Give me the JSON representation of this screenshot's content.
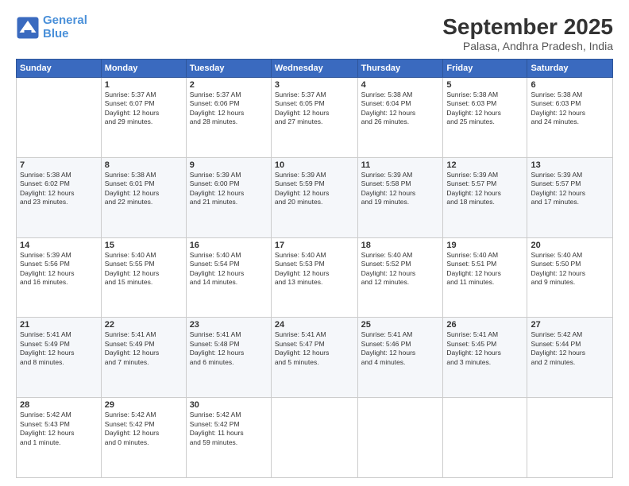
{
  "app": {
    "logo_line1": "General",
    "logo_line2": "Blue"
  },
  "header": {
    "title": "September 2025",
    "subtitle": "Palasa, Andhra Pradesh, India"
  },
  "weekdays": [
    "Sunday",
    "Monday",
    "Tuesday",
    "Wednesday",
    "Thursday",
    "Friday",
    "Saturday"
  ],
  "weeks": [
    [
      {
        "day": "",
        "info": ""
      },
      {
        "day": "1",
        "info": "Sunrise: 5:37 AM\nSunset: 6:07 PM\nDaylight: 12 hours\nand 29 minutes."
      },
      {
        "day": "2",
        "info": "Sunrise: 5:37 AM\nSunset: 6:06 PM\nDaylight: 12 hours\nand 28 minutes."
      },
      {
        "day": "3",
        "info": "Sunrise: 5:37 AM\nSunset: 6:05 PM\nDaylight: 12 hours\nand 27 minutes."
      },
      {
        "day": "4",
        "info": "Sunrise: 5:38 AM\nSunset: 6:04 PM\nDaylight: 12 hours\nand 26 minutes."
      },
      {
        "day": "5",
        "info": "Sunrise: 5:38 AM\nSunset: 6:03 PM\nDaylight: 12 hours\nand 25 minutes."
      },
      {
        "day": "6",
        "info": "Sunrise: 5:38 AM\nSunset: 6:03 PM\nDaylight: 12 hours\nand 24 minutes."
      }
    ],
    [
      {
        "day": "7",
        "info": "Sunrise: 5:38 AM\nSunset: 6:02 PM\nDaylight: 12 hours\nand 23 minutes."
      },
      {
        "day": "8",
        "info": "Sunrise: 5:38 AM\nSunset: 6:01 PM\nDaylight: 12 hours\nand 22 minutes."
      },
      {
        "day": "9",
        "info": "Sunrise: 5:39 AM\nSunset: 6:00 PM\nDaylight: 12 hours\nand 21 minutes."
      },
      {
        "day": "10",
        "info": "Sunrise: 5:39 AM\nSunset: 5:59 PM\nDaylight: 12 hours\nand 20 minutes."
      },
      {
        "day": "11",
        "info": "Sunrise: 5:39 AM\nSunset: 5:58 PM\nDaylight: 12 hours\nand 19 minutes."
      },
      {
        "day": "12",
        "info": "Sunrise: 5:39 AM\nSunset: 5:57 PM\nDaylight: 12 hours\nand 18 minutes."
      },
      {
        "day": "13",
        "info": "Sunrise: 5:39 AM\nSunset: 5:57 PM\nDaylight: 12 hours\nand 17 minutes."
      }
    ],
    [
      {
        "day": "14",
        "info": "Sunrise: 5:39 AM\nSunset: 5:56 PM\nDaylight: 12 hours\nand 16 minutes."
      },
      {
        "day": "15",
        "info": "Sunrise: 5:40 AM\nSunset: 5:55 PM\nDaylight: 12 hours\nand 15 minutes."
      },
      {
        "day": "16",
        "info": "Sunrise: 5:40 AM\nSunset: 5:54 PM\nDaylight: 12 hours\nand 14 minutes."
      },
      {
        "day": "17",
        "info": "Sunrise: 5:40 AM\nSunset: 5:53 PM\nDaylight: 12 hours\nand 13 minutes."
      },
      {
        "day": "18",
        "info": "Sunrise: 5:40 AM\nSunset: 5:52 PM\nDaylight: 12 hours\nand 12 minutes."
      },
      {
        "day": "19",
        "info": "Sunrise: 5:40 AM\nSunset: 5:51 PM\nDaylight: 12 hours\nand 11 minutes."
      },
      {
        "day": "20",
        "info": "Sunrise: 5:40 AM\nSunset: 5:50 PM\nDaylight: 12 hours\nand 9 minutes."
      }
    ],
    [
      {
        "day": "21",
        "info": "Sunrise: 5:41 AM\nSunset: 5:49 PM\nDaylight: 12 hours\nand 8 minutes."
      },
      {
        "day": "22",
        "info": "Sunrise: 5:41 AM\nSunset: 5:49 PM\nDaylight: 12 hours\nand 7 minutes."
      },
      {
        "day": "23",
        "info": "Sunrise: 5:41 AM\nSunset: 5:48 PM\nDaylight: 12 hours\nand 6 minutes."
      },
      {
        "day": "24",
        "info": "Sunrise: 5:41 AM\nSunset: 5:47 PM\nDaylight: 12 hours\nand 5 minutes."
      },
      {
        "day": "25",
        "info": "Sunrise: 5:41 AM\nSunset: 5:46 PM\nDaylight: 12 hours\nand 4 minutes."
      },
      {
        "day": "26",
        "info": "Sunrise: 5:41 AM\nSunset: 5:45 PM\nDaylight: 12 hours\nand 3 minutes."
      },
      {
        "day": "27",
        "info": "Sunrise: 5:42 AM\nSunset: 5:44 PM\nDaylight: 12 hours\nand 2 minutes."
      }
    ],
    [
      {
        "day": "28",
        "info": "Sunrise: 5:42 AM\nSunset: 5:43 PM\nDaylight: 12 hours\nand 1 minute."
      },
      {
        "day": "29",
        "info": "Sunrise: 5:42 AM\nSunset: 5:42 PM\nDaylight: 12 hours\nand 0 minutes."
      },
      {
        "day": "30",
        "info": "Sunrise: 5:42 AM\nSunset: 5:42 PM\nDaylight: 11 hours\nand 59 minutes."
      },
      {
        "day": "",
        "info": ""
      },
      {
        "day": "",
        "info": ""
      },
      {
        "day": "",
        "info": ""
      },
      {
        "day": "",
        "info": ""
      }
    ]
  ]
}
